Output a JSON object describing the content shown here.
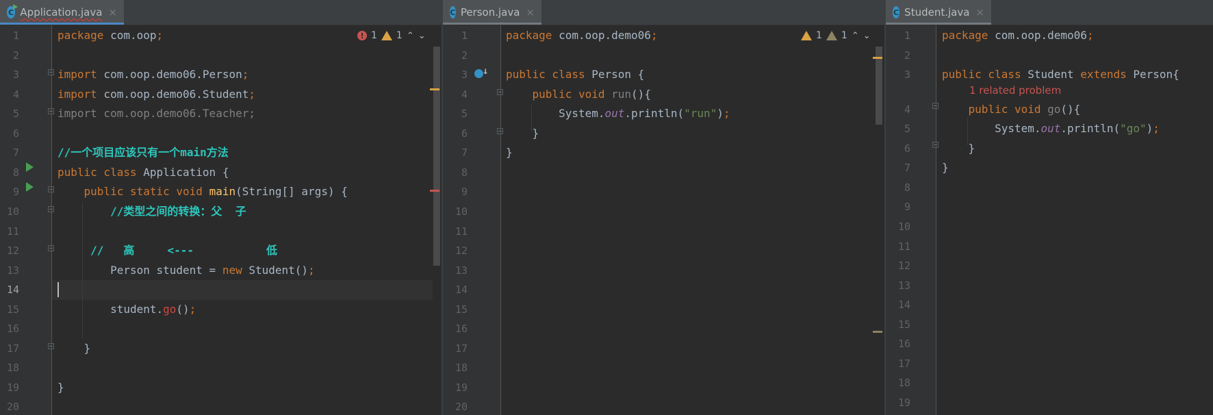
{
  "colors": {
    "background": "#2b2b2b",
    "gutter": "#313335",
    "tab_active_underline": "#4a88c7",
    "keyword": "#cc7832",
    "comment": "#2cc7bd",
    "string": "#6a8759",
    "error": "#d2463f",
    "warning": "#d9a343"
  },
  "panes": [
    {
      "tab": {
        "label": "Application.java",
        "icon": "java-class-runnable-icon",
        "close": "×",
        "active": true,
        "has_error": true
      },
      "inspections": {
        "errors": "1",
        "warnings": "1",
        "prev": "⌃",
        "next": "⌄"
      },
      "current_line": 14,
      "lines": [
        [
          {
            "t": "package",
            "c": "kw"
          },
          {
            "t": " com.oop",
            "c": "plain"
          },
          {
            "t": ";",
            "c": "kw"
          }
        ],
        [],
        [
          {
            "t": "import",
            "c": "kw"
          },
          {
            "t": " com.oop.demo06.Person",
            "c": "plain"
          },
          {
            "t": ";",
            "c": "kw"
          }
        ],
        [
          {
            "t": "import",
            "c": "kw"
          },
          {
            "t": " com.oop.demo06.Student",
            "c": "plain"
          },
          {
            "t": ";",
            "c": "kw"
          }
        ],
        [
          {
            "t": "import com.oop.demo06.Teacher;",
            "c": "unused"
          }
        ],
        [],
        [
          {
            "t": "//一个项目应该只有一个main方法",
            "c": "comment"
          }
        ],
        [
          {
            "t": "public class",
            "c": "kw"
          },
          {
            "t": " Application {",
            "c": "plain"
          }
        ],
        [
          {
            "t": "    ",
            "c": "plain"
          },
          {
            "t": "public static void",
            "c": "kw"
          },
          {
            "t": " ",
            "c": "plain"
          },
          {
            "t": "main",
            "c": "method"
          },
          {
            "t": "(String[] args) {",
            "c": "plain"
          }
        ],
        [
          {
            "t": "        //类型之间的转换：父  子",
            "c": "comment"
          }
        ],
        [],
        [
          {
            "t": "     //   高     <---           低",
            "c": "comment"
          }
        ],
        [
          {
            "t": "        Person student = ",
            "c": "plain"
          },
          {
            "t": "new",
            "c": "kw"
          },
          {
            "t": " Student()",
            "c": "plain"
          },
          {
            "t": ";",
            "c": "kw"
          }
        ],
        [],
        [
          {
            "t": "        student.",
            "c": "plain"
          },
          {
            "t": "go",
            "c": "error"
          },
          {
            "t": "()",
            "c": "plain"
          },
          {
            "t": ";",
            "c": "kw"
          }
        ],
        [],
        [
          {
            "t": "    }",
            "c": "plain"
          }
        ],
        [],
        [
          {
            "t": "}",
            "c": "plain"
          }
        ],
        []
      ]
    },
    {
      "tab": {
        "label": "Person.java",
        "icon": "java-class-icon",
        "close": "×",
        "active": false,
        "has_error": false
      },
      "inspections": {
        "warnings": "1",
        "weak_warnings": "1",
        "prev": "⌃",
        "next": "⌄"
      },
      "lines": [
        [
          {
            "t": "package",
            "c": "kw"
          },
          {
            "t": " com.oop.demo06",
            "c": "plain"
          },
          {
            "t": ";",
            "c": "kw"
          }
        ],
        [],
        [
          {
            "t": "public class",
            "c": "kw"
          },
          {
            "t": " Person {",
            "c": "plain"
          }
        ],
        [
          {
            "t": "    ",
            "c": "plain"
          },
          {
            "t": "public void",
            "c": "kw"
          },
          {
            "t": " ",
            "c": "plain"
          },
          {
            "t": "run",
            "c": "unused"
          },
          {
            "t": "(){",
            "c": "plain"
          }
        ],
        [
          {
            "t": "        System.",
            "c": "plain"
          },
          {
            "t": "out",
            "c": "field"
          },
          {
            "t": ".println(",
            "c": "plain"
          },
          {
            "t": "\"run\"",
            "c": "string"
          },
          {
            "t": ")",
            "c": "plain"
          },
          {
            "t": ";",
            "c": "kw"
          }
        ],
        [
          {
            "t": "    }",
            "c": "plain"
          }
        ],
        [
          {
            "t": "}",
            "c": "plain"
          }
        ],
        [],
        [],
        [],
        [],
        [],
        [],
        [],
        [],
        [],
        [],
        [],
        [],
        []
      ]
    },
    {
      "tab": {
        "label": "Student.java",
        "icon": "java-class-icon",
        "close": "×",
        "active": false,
        "has_error": false
      },
      "inlay_after_line": 3,
      "inlay_text": "1 related problem",
      "lines": [
        [
          {
            "t": "package",
            "c": "kw"
          },
          {
            "t": " com.oop.demo06",
            "c": "plain"
          },
          {
            "t": ";",
            "c": "kw"
          }
        ],
        [],
        [
          {
            "t": "public class",
            "c": "kw"
          },
          {
            "t": " Student ",
            "c": "plain"
          },
          {
            "t": "extends",
            "c": "kw"
          },
          {
            "t": " Person{",
            "c": "plain"
          }
        ],
        [
          {
            "t": "    ",
            "c": "plain"
          },
          {
            "t": "public void",
            "c": "kw"
          },
          {
            "t": " ",
            "c": "plain"
          },
          {
            "t": "go",
            "c": "unused"
          },
          {
            "t": "(){",
            "c": "plain"
          }
        ],
        [
          {
            "t": "        System.",
            "c": "plain"
          },
          {
            "t": "out",
            "c": "field"
          },
          {
            "t": ".println(",
            "c": "plain"
          },
          {
            "t": "\"go\"",
            "c": "string"
          },
          {
            "t": ")",
            "c": "plain"
          },
          {
            "t": ";",
            "c": "kw"
          }
        ],
        [
          {
            "t": "    }",
            "c": "plain"
          }
        ],
        [
          {
            "t": "}",
            "c": "plain"
          }
        ],
        [],
        [],
        [],
        [],
        [],
        [],
        [],
        [],
        [],
        [],
        [],
        []
      ]
    }
  ]
}
